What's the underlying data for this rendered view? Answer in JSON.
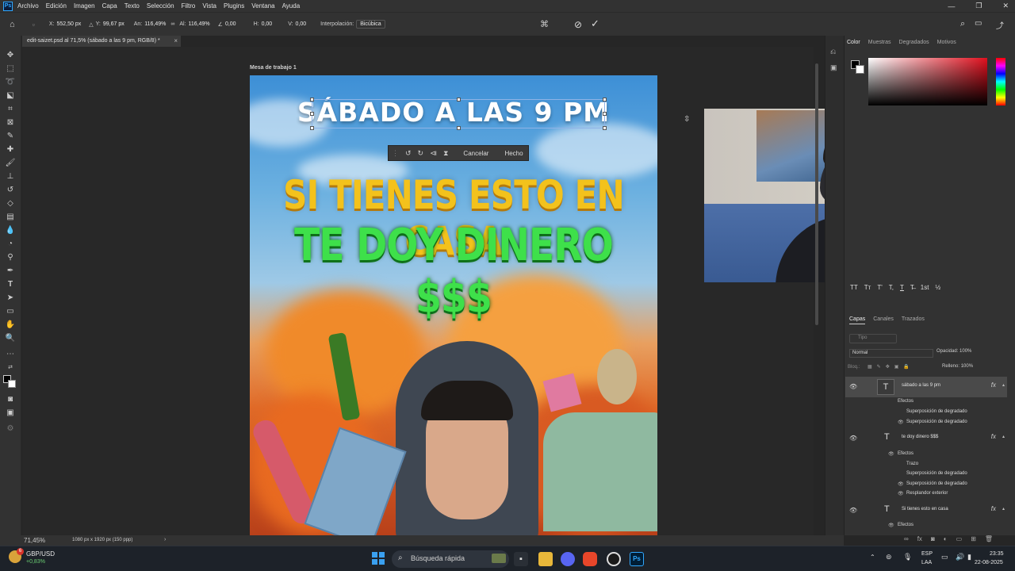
{
  "menubar": {
    "app_icon": "Ps",
    "items": [
      "Archivo",
      "Edición",
      "Imagen",
      "Capa",
      "Texto",
      "Selección",
      "Filtro",
      "Vista",
      "Plugins",
      "Ventana",
      "Ayuda"
    ],
    "window_controls": [
      "—",
      "❐",
      "✕"
    ]
  },
  "options": {
    "x_label": "X:",
    "x_value": "552,50 px",
    "y_label": "Y:",
    "y_value": "99,67 px",
    "w_label": "An:",
    "w_value": "116,49%",
    "h_label": "Al:",
    "h_value": "116,49%",
    "angle_value": "0,00",
    "hskew_label": "H:",
    "hskew_value": "0,00",
    "vskew_label": "V:",
    "vskew_value": "0,00",
    "interp_label": "Interpolación:",
    "interp_value": "Bicúbica"
  },
  "document": {
    "tab_title": "edit-saizet.psd al 71,5% (sábado a las 9 pm, RGB/8) *",
    "artboard_label": "Mesa de trabajo 1"
  },
  "artwork": {
    "title": "SÁBADO A LAS 9 PM",
    "line1": "SI TIENES ESTO EN CASA",
    "line2": "TE DOY DINERO $$$"
  },
  "context_bar": {
    "cancel_label": "Cancelar",
    "done_label": "Hecho"
  },
  "color_panel": {
    "tabs": [
      "Color",
      "Muestras",
      "Degradados",
      "Motivos"
    ],
    "foreground": "#000000",
    "background": "#ffffff",
    "field_hue": "#e0101e"
  },
  "character_row": [
    "TT",
    "Tт",
    "T'",
    "T,",
    "T",
    "T̶",
    "1st",
    "½"
  ],
  "layers_panel": {
    "tabs": [
      "Capas",
      "Canales",
      "Trazados"
    ],
    "search_placeholder": "Tipo",
    "blend_mode": "Normal",
    "opacity_label": "Opacidad:",
    "opacity_value": "100%",
    "lock_label": "Bloq.:",
    "fill_label": "Relleno:",
    "fill_value": "100%",
    "layers": [
      {
        "name": "sábado a las 9 pm",
        "effects_label": "Efectos",
        "effects": [
          "Superposición de degradado",
          "Superposición de degradado"
        ]
      },
      {
        "name": "te doy dinero $$$",
        "effects_label": "Efectos",
        "effects": [
          "Trazo",
          "Superposición de degradado",
          "Superposición de degradado",
          "Resplandor exterior"
        ]
      },
      {
        "name": "Si tienes esto en casa",
        "effects_label": "Efectos",
        "effects": []
      }
    ],
    "fx_label": "fx"
  },
  "status": {
    "zoom": "71,45%",
    "dimensions": "1080 px x 1920 px (150 ppp)"
  },
  "taskbar": {
    "ticker_name": "GBP/USD",
    "ticker_change": "+0,83%",
    "weather_badge": "6",
    "search_placeholder": "Búsqueda rápida",
    "lang_top": "ESP",
    "lang_bottom": "LAA",
    "time": "23:35",
    "date": "22-08-2025"
  }
}
